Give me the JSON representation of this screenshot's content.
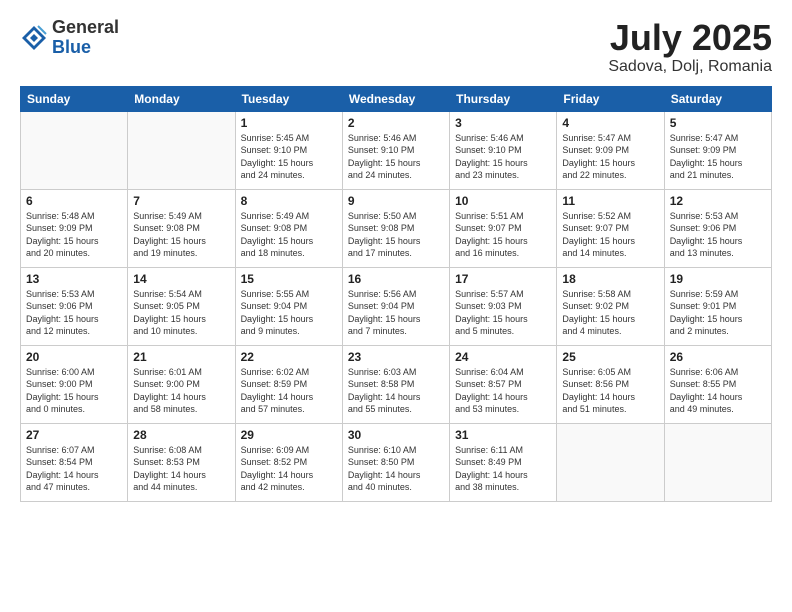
{
  "logo": {
    "general": "General",
    "blue": "Blue"
  },
  "header": {
    "month_year": "July 2025",
    "location": "Sadova, Dolj, Romania"
  },
  "weekdays": [
    "Sunday",
    "Monday",
    "Tuesday",
    "Wednesday",
    "Thursday",
    "Friday",
    "Saturday"
  ],
  "weeks": [
    [
      {
        "day": "",
        "info": ""
      },
      {
        "day": "",
        "info": ""
      },
      {
        "day": "1",
        "info": "Sunrise: 5:45 AM\nSunset: 9:10 PM\nDaylight: 15 hours\nand 24 minutes."
      },
      {
        "day": "2",
        "info": "Sunrise: 5:46 AM\nSunset: 9:10 PM\nDaylight: 15 hours\nand 24 minutes."
      },
      {
        "day": "3",
        "info": "Sunrise: 5:46 AM\nSunset: 9:10 PM\nDaylight: 15 hours\nand 23 minutes."
      },
      {
        "day": "4",
        "info": "Sunrise: 5:47 AM\nSunset: 9:09 PM\nDaylight: 15 hours\nand 22 minutes."
      },
      {
        "day": "5",
        "info": "Sunrise: 5:47 AM\nSunset: 9:09 PM\nDaylight: 15 hours\nand 21 minutes."
      }
    ],
    [
      {
        "day": "6",
        "info": "Sunrise: 5:48 AM\nSunset: 9:09 PM\nDaylight: 15 hours\nand 20 minutes."
      },
      {
        "day": "7",
        "info": "Sunrise: 5:49 AM\nSunset: 9:08 PM\nDaylight: 15 hours\nand 19 minutes."
      },
      {
        "day": "8",
        "info": "Sunrise: 5:49 AM\nSunset: 9:08 PM\nDaylight: 15 hours\nand 18 minutes."
      },
      {
        "day": "9",
        "info": "Sunrise: 5:50 AM\nSunset: 9:08 PM\nDaylight: 15 hours\nand 17 minutes."
      },
      {
        "day": "10",
        "info": "Sunrise: 5:51 AM\nSunset: 9:07 PM\nDaylight: 15 hours\nand 16 minutes."
      },
      {
        "day": "11",
        "info": "Sunrise: 5:52 AM\nSunset: 9:07 PM\nDaylight: 15 hours\nand 14 minutes."
      },
      {
        "day": "12",
        "info": "Sunrise: 5:53 AM\nSunset: 9:06 PM\nDaylight: 15 hours\nand 13 minutes."
      }
    ],
    [
      {
        "day": "13",
        "info": "Sunrise: 5:53 AM\nSunset: 9:06 PM\nDaylight: 15 hours\nand 12 minutes."
      },
      {
        "day": "14",
        "info": "Sunrise: 5:54 AM\nSunset: 9:05 PM\nDaylight: 15 hours\nand 10 minutes."
      },
      {
        "day": "15",
        "info": "Sunrise: 5:55 AM\nSunset: 9:04 PM\nDaylight: 15 hours\nand 9 minutes."
      },
      {
        "day": "16",
        "info": "Sunrise: 5:56 AM\nSunset: 9:04 PM\nDaylight: 15 hours\nand 7 minutes."
      },
      {
        "day": "17",
        "info": "Sunrise: 5:57 AM\nSunset: 9:03 PM\nDaylight: 15 hours\nand 5 minutes."
      },
      {
        "day": "18",
        "info": "Sunrise: 5:58 AM\nSunset: 9:02 PM\nDaylight: 15 hours\nand 4 minutes."
      },
      {
        "day": "19",
        "info": "Sunrise: 5:59 AM\nSunset: 9:01 PM\nDaylight: 15 hours\nand 2 minutes."
      }
    ],
    [
      {
        "day": "20",
        "info": "Sunrise: 6:00 AM\nSunset: 9:00 PM\nDaylight: 15 hours\nand 0 minutes."
      },
      {
        "day": "21",
        "info": "Sunrise: 6:01 AM\nSunset: 9:00 PM\nDaylight: 14 hours\nand 58 minutes."
      },
      {
        "day": "22",
        "info": "Sunrise: 6:02 AM\nSunset: 8:59 PM\nDaylight: 14 hours\nand 57 minutes."
      },
      {
        "day": "23",
        "info": "Sunrise: 6:03 AM\nSunset: 8:58 PM\nDaylight: 14 hours\nand 55 minutes."
      },
      {
        "day": "24",
        "info": "Sunrise: 6:04 AM\nSunset: 8:57 PM\nDaylight: 14 hours\nand 53 minutes."
      },
      {
        "day": "25",
        "info": "Sunrise: 6:05 AM\nSunset: 8:56 PM\nDaylight: 14 hours\nand 51 minutes."
      },
      {
        "day": "26",
        "info": "Sunrise: 6:06 AM\nSunset: 8:55 PM\nDaylight: 14 hours\nand 49 minutes."
      }
    ],
    [
      {
        "day": "27",
        "info": "Sunrise: 6:07 AM\nSunset: 8:54 PM\nDaylight: 14 hours\nand 47 minutes."
      },
      {
        "day": "28",
        "info": "Sunrise: 6:08 AM\nSunset: 8:53 PM\nDaylight: 14 hours\nand 44 minutes."
      },
      {
        "day": "29",
        "info": "Sunrise: 6:09 AM\nSunset: 8:52 PM\nDaylight: 14 hours\nand 42 minutes."
      },
      {
        "day": "30",
        "info": "Sunrise: 6:10 AM\nSunset: 8:50 PM\nDaylight: 14 hours\nand 40 minutes."
      },
      {
        "day": "31",
        "info": "Sunrise: 6:11 AM\nSunset: 8:49 PM\nDaylight: 14 hours\nand 38 minutes."
      },
      {
        "day": "",
        "info": ""
      },
      {
        "day": "",
        "info": ""
      }
    ]
  ]
}
